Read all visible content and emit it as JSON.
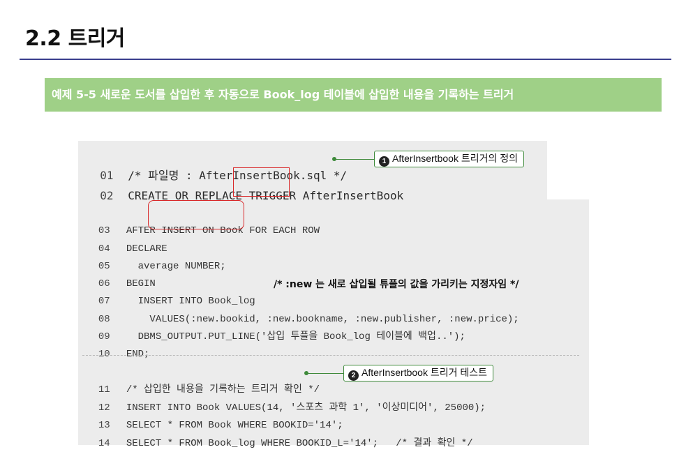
{
  "section_title": "2.2 트리거",
  "example_banner": "예제 5-5 새로운 도서를 삽입한 후 자동으로 Book_log 테이블에 삽입한 내용을 기록하는 트리거",
  "code_lines": [
    {
      "num": "01",
      "text": "/* 파일명 : AfterInsertBook.sql */"
    },
    {
      "num": "02",
      "text": "CREATE OR REPLACE TRIGGER AfterInsertBook"
    },
    {
      "num": "03",
      "text": "AFTER INSERT ON Book FOR EACH ROW"
    },
    {
      "num": "04",
      "text": "DECLARE"
    },
    {
      "num": "05",
      "text": "  average NUMBER;"
    },
    {
      "num": "06",
      "text": "BEGIN"
    },
    {
      "num": "07",
      "text": "  INSERT INTO Book_log"
    },
    {
      "num": "08",
      "text": "    VALUES(:new.bookid, :new.bookname, :new.publisher, :new.price);"
    },
    {
      "num": "09",
      "text": "  DBMS_OUTPUT.PUT_LINE('삽입 투플을 Book_log 테이블에 백업..');"
    },
    {
      "num": "10",
      "text": "END;"
    },
    {
      "num": "11",
      "text": "/* 삽입한 내용을 기록하는 트리거 확인 */"
    },
    {
      "num": "12",
      "text": "INSERT INTO Book VALUES(14, '스포츠 과학 1', '이상미디어', 25000);"
    },
    {
      "num": "13",
      "text": "SELECT * FROM Book WHERE BOOKID='14';"
    },
    {
      "num": "14",
      "text": "SELECT * FROM Book_log WHERE BOOKID_L='14';   /* 결과 확인 */"
    }
  ],
  "line7_comment": "/* :new 는 새로 삽입될 튜플의 값을 가리키는 지정자임 */",
  "callouts": [
    {
      "badge": "1",
      "text": "AfterInsertbook 트리거의 정의"
    },
    {
      "badge": "2",
      "text": "AfterInsertbook 트리거 테스트"
    }
  ],
  "colors": {
    "banner_bg": "#9fd087",
    "rule": "#3b3f8e",
    "highlight_box": "#d9292a",
    "callout_border": "#3e8a3a",
    "code_bg": "#ececec"
  }
}
